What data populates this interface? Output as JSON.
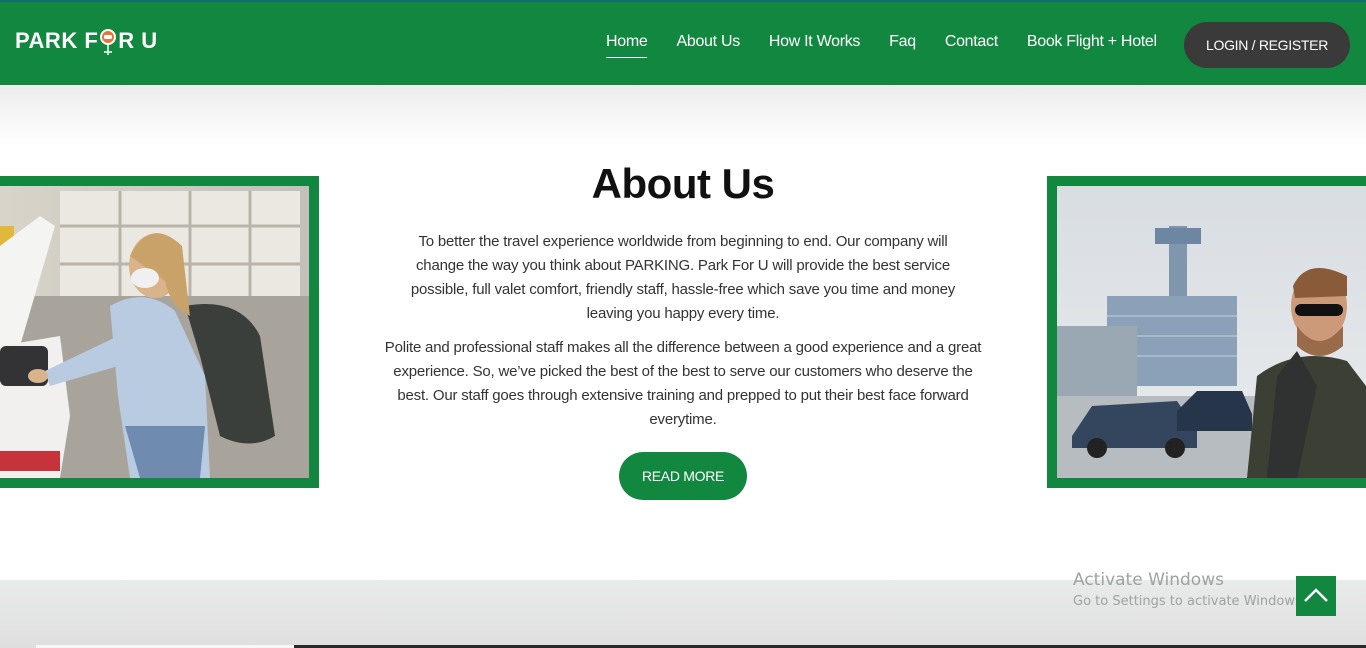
{
  "brand": {
    "logo_left": "PARK F",
    "logo_right": "R U",
    "logo_icon": "car-pin-icon"
  },
  "nav": {
    "items": [
      "Home",
      "About Us",
      "How It Works",
      "Faq",
      "Contact",
      "Book Flight + Hotel"
    ],
    "active": "Home",
    "login": "LOGIN / REGISTER"
  },
  "about": {
    "title": "About Us",
    "paragraph1": "To better the travel experience worldwide from beginning to end. Our company will change the way you think about PARKING. Park For U will provide the best service possible, full valet comfort, friendly staff, hassle-free which save you time and money leaving you happy every time.",
    "paragraph2": "Polite and professional staff makes all the difference between a good experience and a great experience. So, we’ve picked the best of the best to serve our customers who deserve the best. Our staff goes through extensive training and prepped to put their best face forward everytime.",
    "button": "READ MORE"
  },
  "watermark": {
    "line1": "Activate Windows",
    "line2": "Go to Settings to activate Windows."
  },
  "colors": {
    "brand_green": "#12873f",
    "dark_button": "#3a3a3a"
  },
  "icons": {
    "scroll_top": "chevron-up-icon"
  }
}
